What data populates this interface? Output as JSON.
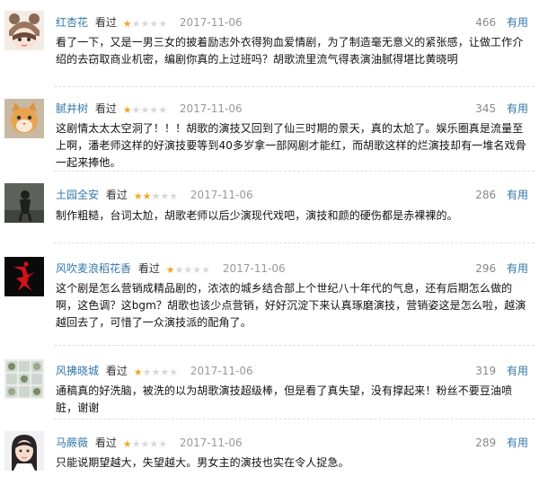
{
  "reviews": [
    {
      "user": "红杏花",
      "watched": "看过",
      "stars": 1,
      "date": "2017-11-06",
      "votes": "466",
      "useful": "有用",
      "content": "看了一下，又是一男三女的披着励志外衣得狗血爱情剧，为了制造毫无意义的紧张感，让做工作介绍的去窃取商业机密，编剧你真的上过班吗？胡歌流里流气得表演油腻得堪比黄晓明",
      "avatar_icon": "anime-bear-hat-avatar-icon"
    },
    {
      "user": "腻井树",
      "watched": "看过",
      "stars": 1,
      "date": "2017-11-06",
      "votes": "345",
      "useful": "有用",
      "content": "这剧情太太太空洞了！！！胡歌的演技又回到了仙三时期的景天，真的太尬了。娱乐圈真是流量至上啊，潘老师这样的好演技要等到40多岁拿一部网剧才能红，而胡歌这样的烂演技却有一堆名戏骨一起来捧他。",
      "avatar_icon": "cat-avatar-icon"
    },
    {
      "user": "土园全安",
      "watched": "看过",
      "stars": 2,
      "date": "2017-11-06",
      "votes": "286",
      "useful": "有用",
      "content": "制作粗糙，台词太尬，胡歌老师以后少演现代戏吧，演技和颜的硬伤都是赤裸裸的。",
      "avatar_icon": "dark-figure-avatar-icon"
    },
    {
      "user": "风吹麦浪稻花香",
      "watched": "看过",
      "stars": 1,
      "date": "2017-11-06",
      "votes": "296",
      "useful": "有用",
      "content": "这个剧是怎么营销成精品剧的，浓浓的城乡结合部上个世纪八十年代的气息，还有后期怎么做的啊，这色调？这bgm？胡歌也该少点营销，好好沉淀下来认真琢磨演技，营销姿这是怎么啦，越演越回去了，可惜了一众演技派的配角了。",
      "avatar_icon": "jumpman-logo-avatar-icon"
    },
    {
      "user": "风拂晓城",
      "watched": "看过",
      "stars": 1,
      "date": "2017-11-06",
      "votes": "319",
      "useful": "有用",
      "content": "通稿真的好洗脑，被洗的以为胡歌演技超级棒，但是看了真失望，没有撑起来！粉丝不要豆油喷脏，谢谢",
      "avatar_icon": "emoji-faces-avatar-icon"
    },
    {
      "user": "马蕨薇",
      "watched": "看过",
      "stars": 1,
      "date": "2017-11-06",
      "votes": "289",
      "useful": "有用",
      "content": "只能说期望越大，失望越大。男女主的演技也实在令人捉急。",
      "avatar_icon": "girl-portrait-avatar-icon"
    }
  ]
}
